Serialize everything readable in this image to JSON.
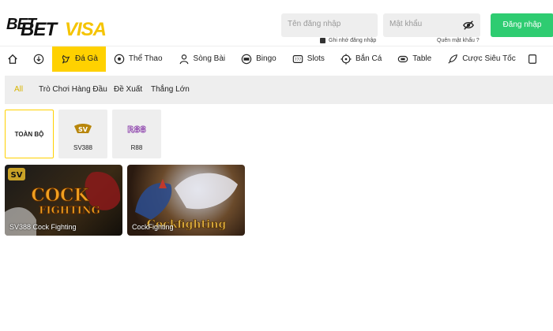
{
  "brand": {
    "part1": "BET",
    "part2": "BET",
    "part3": "VISA"
  },
  "header": {
    "username_placeholder": "Tên đăng nhập",
    "password_placeholder": "Mật khẩu",
    "login_label": "Đăng nhập",
    "remember_label": "Ghi nhớ đăng nhập",
    "forgot_label": "Quên mật khẩu ?"
  },
  "nav": {
    "items": [
      {
        "label": "",
        "icon": "home-icon"
      },
      {
        "label": "",
        "icon": "download-icon"
      },
      {
        "label": "Đá Gà",
        "icon": "rooster-icon",
        "active": true
      },
      {
        "label": "Thể Thao",
        "icon": "soccer-ball-icon"
      },
      {
        "label": "Sòng Bài",
        "icon": "dealer-icon"
      },
      {
        "label": "Bingo",
        "icon": "bingo-icon"
      },
      {
        "label": "Slots",
        "icon": "slot-machine-icon"
      },
      {
        "label": "Bắn Cá",
        "icon": "crosshair-icon"
      },
      {
        "label": "Table",
        "icon": "table-game-icon"
      },
      {
        "label": "Cược Siêu Tốc",
        "icon": "rocket-icon"
      }
    ]
  },
  "filter": {
    "tabs": [
      {
        "label": "All",
        "active": true
      },
      {
        "label": "Trò Chơi Hàng Đầu"
      },
      {
        "label": "Đề Xuất"
      },
      {
        "label": "Thắng Lớn"
      }
    ]
  },
  "providers": [
    {
      "label": "TOÀN BỘ",
      "active": true
    },
    {
      "label": "SV388",
      "logo_text": "SV"
    },
    {
      "label": "R88",
      "logo_text": "R88"
    }
  ],
  "games": [
    {
      "title": "SV388 Cock Fighting",
      "art_text_1": "COCK",
      "art_text_2": "FIGHTING",
      "badge": "SV"
    },
    {
      "title": "CockFighting",
      "art_text_1": "Cockfighting"
    }
  ],
  "colors": {
    "accent": "#ffd100",
    "login": "#2ecc71",
    "panel": "#eeeeee"
  }
}
